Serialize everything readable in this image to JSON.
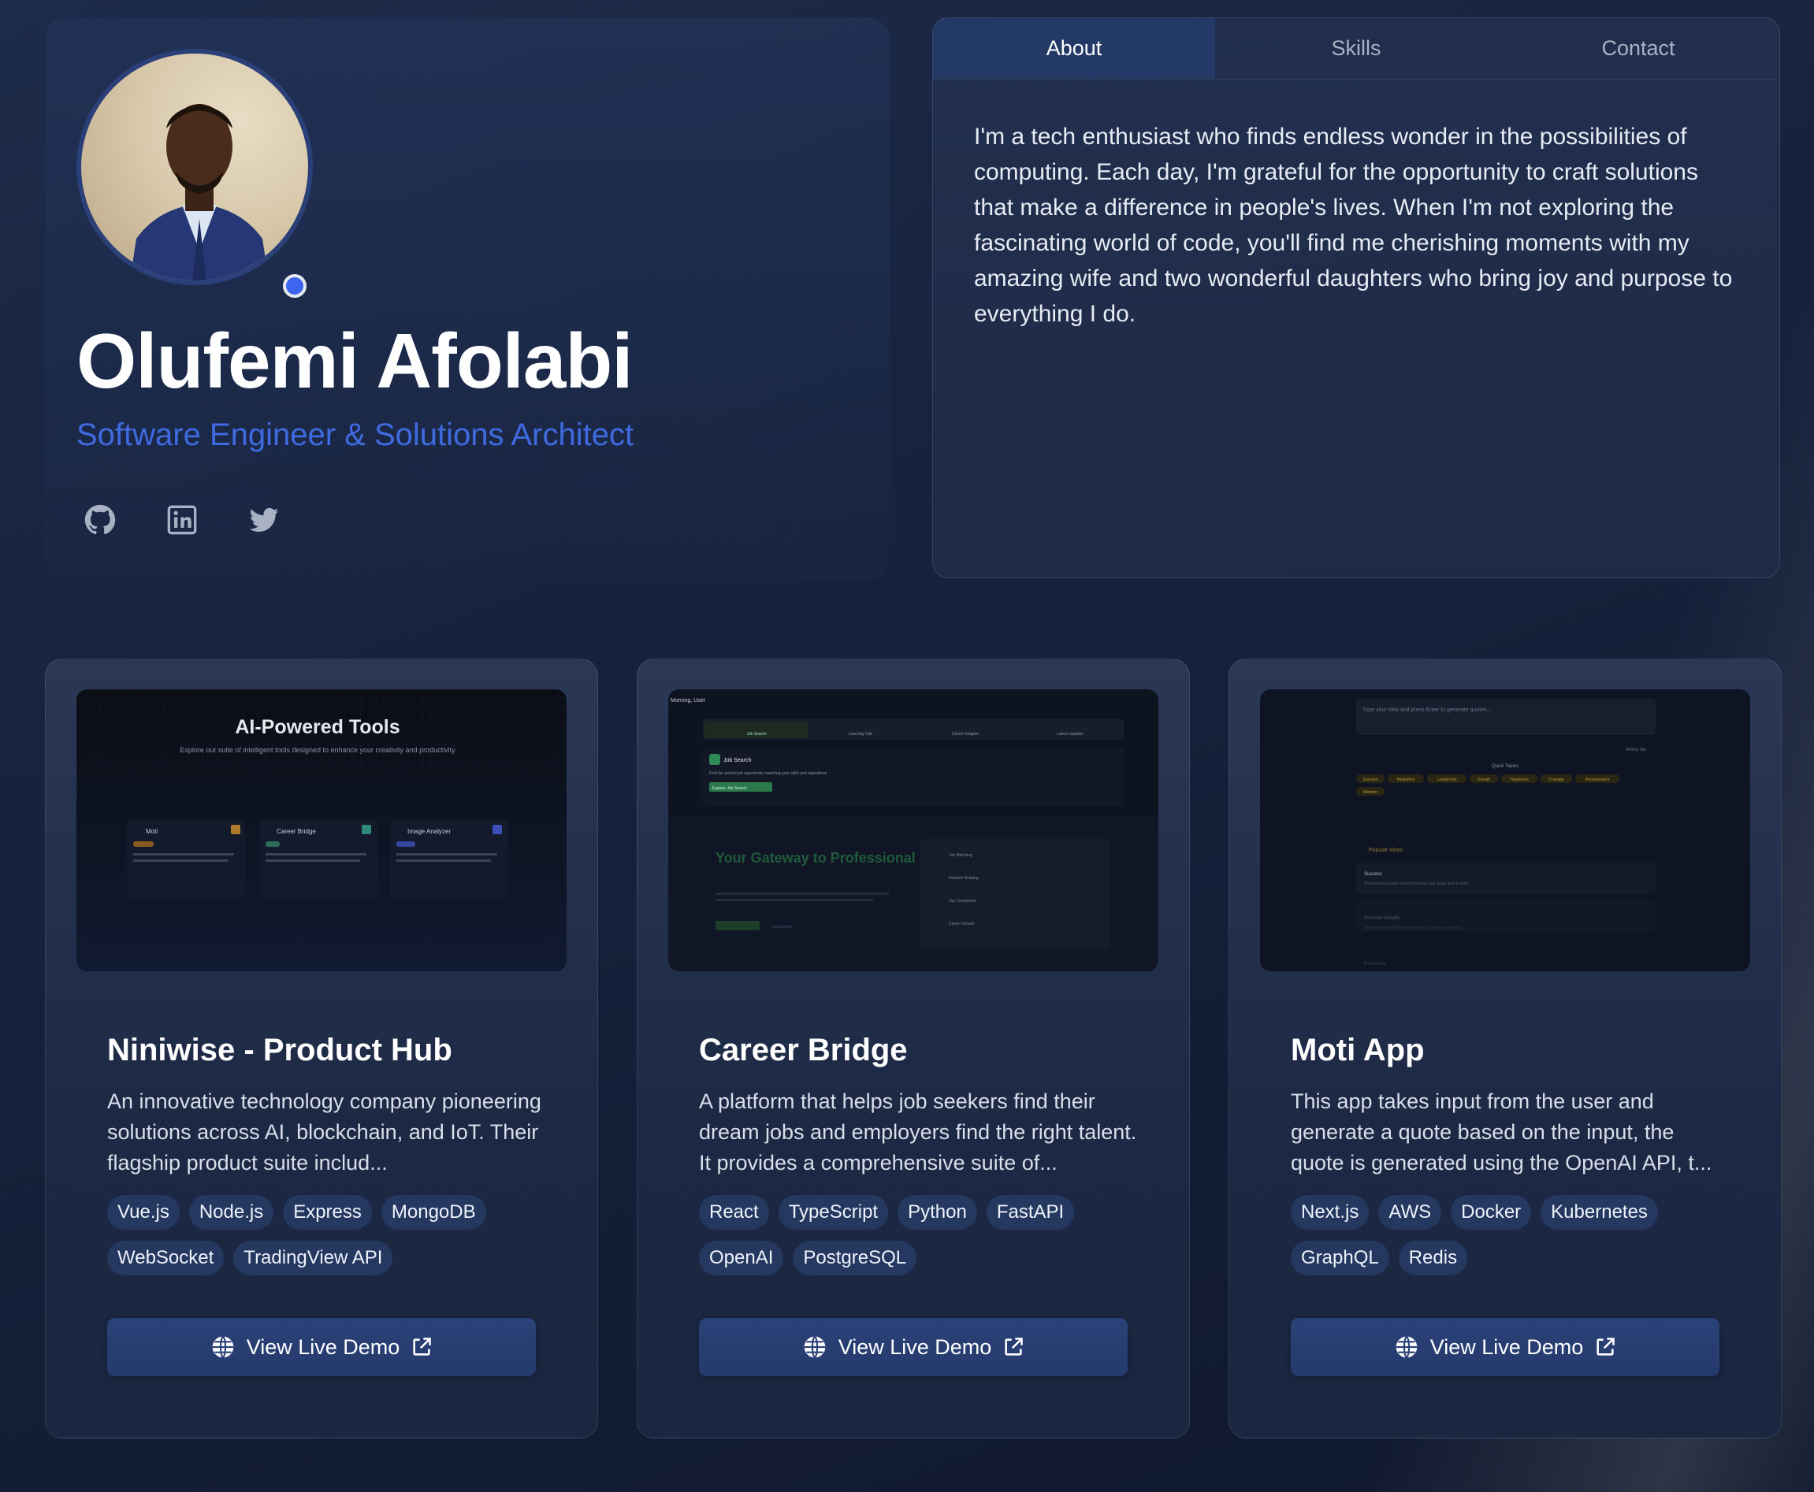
{
  "profile": {
    "name": "Olufemi Afolabi",
    "role": "Software Engineer & Solutions Architect",
    "socials": [
      "github-icon",
      "linkedin-icon",
      "twitter-icon"
    ]
  },
  "tabs": {
    "items": [
      {
        "label": "About",
        "active": true
      },
      {
        "label": "Skills",
        "active": false
      },
      {
        "label": "Contact",
        "active": false
      }
    ],
    "about_text": "I'm a tech enthusiast who finds endless wonder in the possibilities of computing. Each day, I'm grateful for the opportunity to craft solutions that make a difference in people's lives. When I'm not exploring the fascinating world of code, you'll find me cherishing moments with my amazing wife and two wonderful daughters who bring joy and purpose to everything I do."
  },
  "projects": [
    {
      "title": "Niniwise - Product Hub",
      "description": "An innovative technology company pioneering solutions across AI, blockchain, and IoT. Their flagship product suite includ...",
      "tags": [
        "Vue.js",
        "Node.js",
        "Express",
        "MongoDB",
        "WebSocket",
        "TradingView API"
      ],
      "button": "View Live Demo",
      "preview": {
        "heading": "AI-Powered Tools",
        "subheading": "Explore our suite of intelligent tools designed to enhance your creativity and productivity",
        "tools": [
          "Moti",
          "Career Bridge",
          "Image Analyzer"
        ]
      }
    },
    {
      "title": "Career Bridge",
      "description": "A platform that helps job seekers find their dream jobs and employers find the right talent. It provides a comprehensive suite of...",
      "tags": [
        "React",
        "TypeScript",
        "Python",
        "FastAPI",
        "OpenAI",
        "PostgreSQL"
      ],
      "button": "View Live Demo",
      "preview": {
        "greeting": "Morning, User",
        "nav": [
          "Job Search",
          "Learning Hub",
          "Career Insights",
          "Latest Updates"
        ],
        "card_title": "Job Search",
        "card_text": "Find the perfect job opportunity matching your skills and aspirations",
        "card_button": "Explore Job Search",
        "hero": "Your Gateway to Professional Success",
        "features": [
          "Job Matching",
          "Network Building",
          "Top Companies",
          "Career Growth"
        ],
        "learn_more": "Learn More"
      }
    },
    {
      "title": "Moti App",
      "description": "This app takes input from the user and generate a quote based on the input, the quote is generated using the OpenAI API, t...",
      "tags": [
        "Next.js",
        "AWS",
        "Docker",
        "Kubernetes",
        "GraphQL",
        "Redis"
      ],
      "button": "View Live Demo",
      "preview": {
        "input_placeholder": "Type your idea and press Enter to generate quotes...",
        "writing_tips": "Writing Tips",
        "quick_topics_label": "Quick Topics",
        "topics": [
          "Success",
          "Motivation",
          "Leadership",
          "Growth",
          "Happiness",
          "Courage",
          "Perseverance",
          "Wisdom"
        ],
        "popular_label": "Popular Ideas",
        "ideas": [
          {
            "title": "Success",
            "text": "Inspirational quotes about achieving your goals and dreams"
          },
          {
            "title": "Personal Growth",
            "text": "Quotes about self-improvement and continuous learning"
          },
          {
            "title": "Resilience",
            "text": ""
          }
        ]
      }
    }
  ],
  "colors": {
    "accent": "#3f6ae0",
    "tag_bg": "#243860",
    "button_bg": "#2b4278",
    "status_dot": "#3b64f0"
  }
}
